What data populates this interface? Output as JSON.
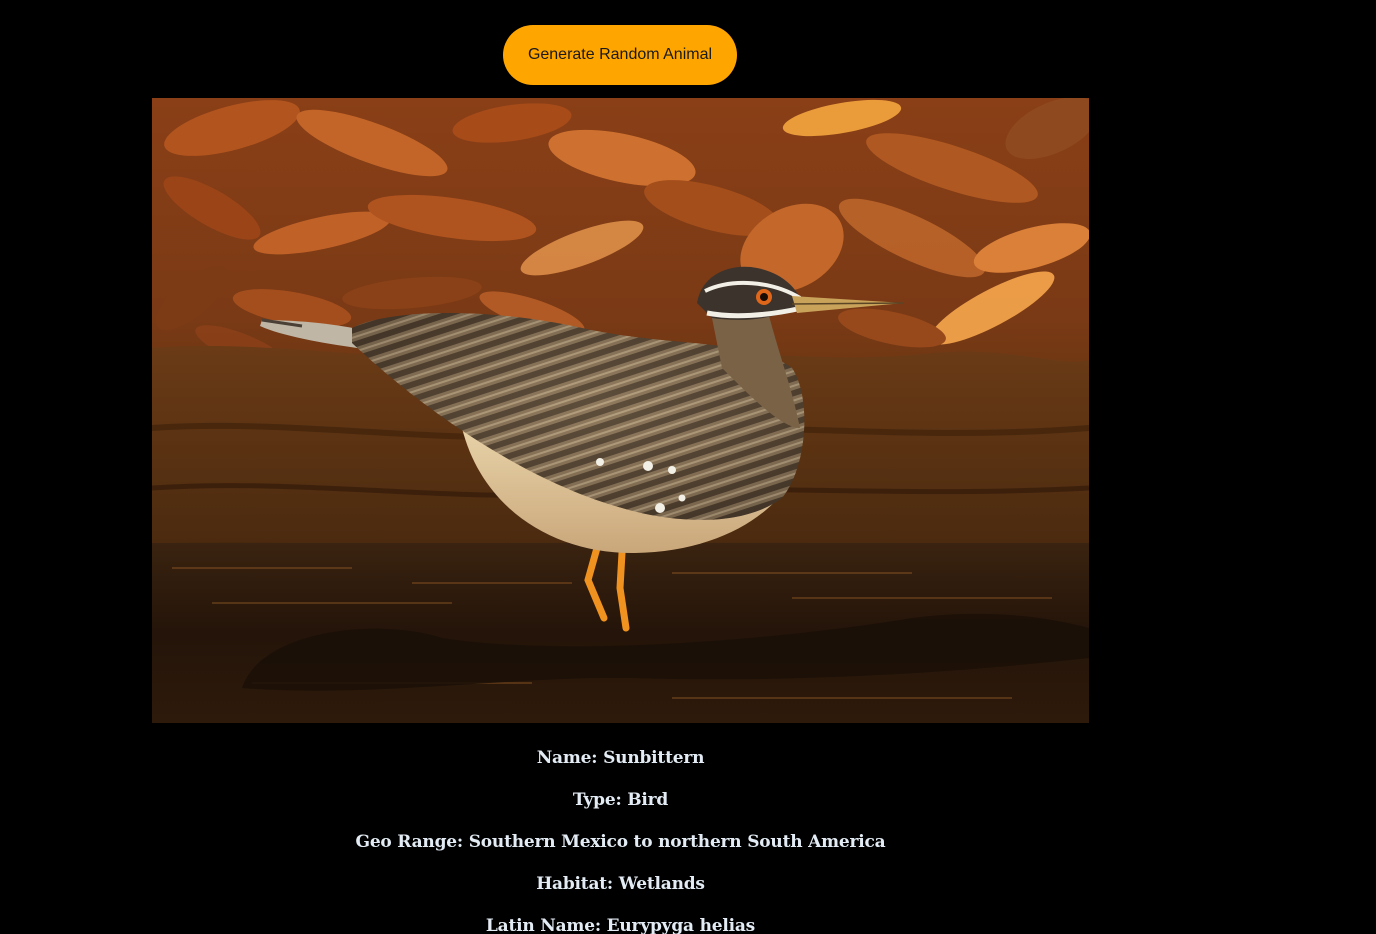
{
  "toolbar": {
    "generate_label": "Generate Random Animal",
    "accent_color": "#ffa500"
  },
  "animal_photo": {
    "subject": "sunbittern-standing-in-shallow-water-photo",
    "background": "dry-orange-leaves-and-mud-bank"
  },
  "info": {
    "name_prefix": "Name:",
    "name": "Sunbittern",
    "type_prefix": "Type:",
    "type": "Bird",
    "geo_prefix": "Geo Range:",
    "geo_range": "Southern Mexico to northern South America",
    "habitat_prefix": "Habitat:",
    "habitat": "Wetlands",
    "latin_prefix": "Latin Name:",
    "latin_name": "Eurypyga helias"
  }
}
